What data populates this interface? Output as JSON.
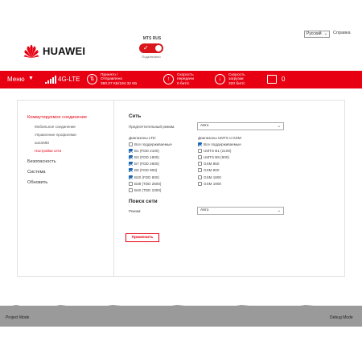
{
  "header": {
    "brand": "HUAWEI",
    "operator": "MTS RUS",
    "toggle_label": "Подключено",
    "language": "Русский",
    "help": "Справка"
  },
  "statusbar": {
    "menu": "Меню",
    "network": "4G-LTE",
    "received_label": "Принято /",
    "sent_label": "Отправлено",
    "traffic": "390.07 КБ/194.32 КБ",
    "upload_label": "Скорость",
    "upload_label2": "передачи",
    "upload_value": "0 бит/с",
    "download_label": "Скорость",
    "download_label2": "загрузки",
    "download_value": "320 бит/с",
    "messages": "0"
  },
  "sidebar": {
    "connection": "Коммутируемое соединение",
    "sub_items": [
      "Мобильное соединение",
      "Управление профилями",
      "Настройки сети"
    ],
    "sub_middle": "autoIMEI",
    "security": "Безопасность",
    "system": "Система",
    "update": "Обновить"
  },
  "network": {
    "title": "Сеть",
    "mode_label": "Предпочтительный режим:",
    "mode_value": "Авто",
    "lte_label": "Диапазоны LTE:",
    "lte_bands": [
      {
        "label": "Все поддерживаемые",
        "checked": false
      },
      {
        "label": "B1 (FDD 2100)",
        "checked": true
      },
      {
        "label": "B3 (FDD 1800)",
        "checked": true
      },
      {
        "label": "B7 (FDD 2600)",
        "checked": true
      },
      {
        "label": "B8 (FDD 900)",
        "checked": true
      },
      {
        "label": "B20 (FDD 800)",
        "checked": true
      },
      {
        "label": "B38 (TDD 2600)",
        "checked": false
      },
      {
        "label": "B40 (TDD 2300)",
        "checked": false
      }
    ],
    "umts_label": "Диапазоны UMTS и GSM:",
    "umts_bands": [
      {
        "label": "Все поддерживаемые",
        "checked": true
      },
      {
        "label": "UMTS B1 (2100)",
        "checked": false
      },
      {
        "label": "UMTS B8 (900)",
        "checked": false
      },
      {
        "label": "GSM 850",
        "checked": false
      },
      {
        "label": "GSM 900",
        "checked": false
      },
      {
        "label": "GSM 1800",
        "checked": false
      },
      {
        "label": "GSM 1900",
        "checked": false
      }
    ]
  },
  "search": {
    "title": "Поиск сети",
    "mode_label": "Режим:",
    "mode_value": "Авто"
  },
  "apply_label": "Применить",
  "footer": {
    "project_mode": "Project Mode",
    "debug_mode": "Debug Mode"
  }
}
